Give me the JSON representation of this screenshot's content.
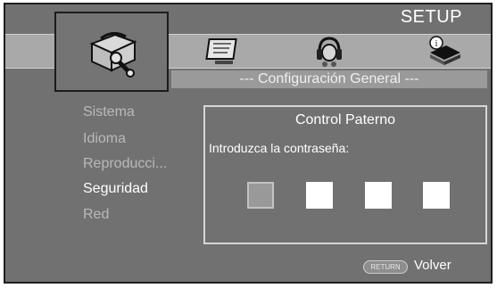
{
  "header": {
    "title": "SETUP"
  },
  "tabs": [
    {
      "icon": "toolbox-wrench-icon",
      "selected": true
    },
    {
      "icon": "tv-screen-icon",
      "selected": false
    },
    {
      "icon": "speaker-headphones-icon",
      "selected": false
    },
    {
      "icon": "info-book-icon",
      "selected": false
    }
  ],
  "subheader": {
    "text": "--- Configuración General ---"
  },
  "sidebar": {
    "items": [
      {
        "label": "Sistema",
        "active": false
      },
      {
        "label": "Idioma",
        "active": false
      },
      {
        "label": "Reproducci...",
        "active": false
      },
      {
        "label": "Seguridad",
        "active": true
      },
      {
        "label": "Red",
        "active": false
      }
    ]
  },
  "panel": {
    "title": "Control Paterno",
    "prompt": "Introduzca la contraseña:",
    "digits": 4,
    "current_digit": 1
  },
  "footer": {
    "return_button": "RETURN",
    "return_label": "Volver"
  },
  "colors": {
    "background": "#717171",
    "icon_band": "#a9a9a9",
    "active_text": "#ffffff",
    "inactive_text": "#b9b9b9"
  }
}
